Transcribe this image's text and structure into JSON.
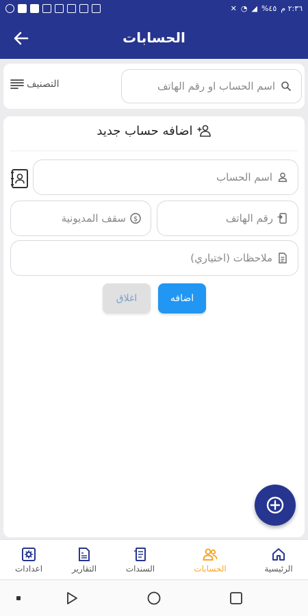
{
  "status_bar": {
    "time": "٢:٣٦ م",
    "battery": "%٤٥"
  },
  "app_bar": {
    "title": "الحسابات"
  },
  "search": {
    "placeholder": "اسم الحساب او رقم الهاتف",
    "sort_label": "التصنيف"
  },
  "form": {
    "title": "اضافه حساب جديد",
    "account_name_placeholder": "اسم الحساب",
    "phone_placeholder": "رقم الهاتف",
    "debt_limit_placeholder": "سقف المديونية",
    "notes_placeholder": "ملاحظات (اختياري)",
    "add_label": "اضافه",
    "close_label": "اغلاق"
  },
  "bottom_nav": {
    "items": [
      {
        "label": "الرئيسية",
        "icon": "home-icon"
      },
      {
        "label": "الحسابات",
        "icon": "users-icon"
      },
      {
        "label": "السندات",
        "icon": "receipt-icon"
      },
      {
        "label": "التقارير",
        "icon": "reports-icon"
      },
      {
        "label": "اعدادات",
        "icon": "gear-icon"
      }
    ],
    "active_index": 1
  },
  "colors": {
    "primary": "#26358f",
    "accent_blue": "#2196f3",
    "active_orange": "#f5a524"
  }
}
